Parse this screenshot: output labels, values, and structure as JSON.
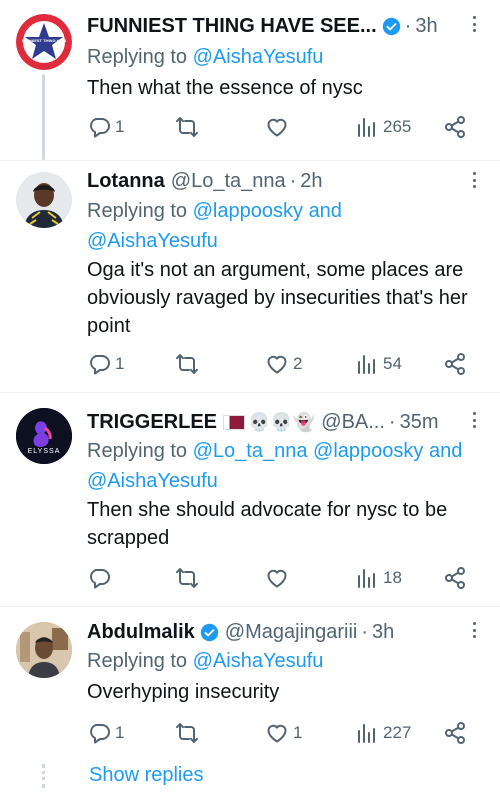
{
  "tweets": [
    {
      "name": "FUNNIEST THING HAVE SEE...",
      "verified": true,
      "handle": "",
      "time": "3h",
      "replying_label": "Replying to",
      "mentions": [
        "@AishaYesufu"
      ],
      "text": "Then what the essence of nysc",
      "replies": "1",
      "retweets": "",
      "likes": "",
      "views": "265",
      "avatar_logo_text": "FUNNIEST THING HAVE SEEN"
    },
    {
      "name": "Lotanna",
      "verified": false,
      "handle": "@Lo_ta_nna",
      "time": "2h",
      "replying_label": "Replying to",
      "mentions": [
        "@lappoosky",
        "@AishaYesufu"
      ],
      "joiner": "and",
      "text": "Oga  it's not an argument, some places are obviously ravaged by insecurities that's her point",
      "replies": "1",
      "retweets": "",
      "likes": "2",
      "views": "54"
    },
    {
      "name": "TRIGGERLEE",
      "verified": false,
      "name_emojis": "💀💀👻",
      "handle": "@BA...",
      "time": "35m",
      "replying_label": "Replying to",
      "mentions": [
        "@Lo_ta_nna",
        "@lappoosky",
        "@AishaYesufu"
      ],
      "joiner": "and",
      "text": "Then she should advocate for nysc to be scrapped",
      "replies": "",
      "retweets": "",
      "likes": "",
      "views": "18",
      "avatar_logo_text": "ELYSSA"
    },
    {
      "name": "Abdulmalik",
      "verified": true,
      "handle": "@Magajingariii",
      "time": "3h",
      "replying_label": "Replying to",
      "mentions": [
        "@AishaYesufu"
      ],
      "text": "Overhyping insecurity",
      "replies": "1",
      "retweets": "",
      "likes": "1",
      "views": "227"
    }
  ],
  "show_replies": "Show replies",
  "separator": "·",
  "colors": {
    "link": "#1d9bf0",
    "secondary": "#536471",
    "verified": "#1d9bf0",
    "thread_line": "#cfd9de"
  },
  "icons": {
    "reply": "reply-icon",
    "retweet": "retweet-icon",
    "like": "heart-icon",
    "views": "views-icon",
    "share": "share-icon",
    "more": "more-icon",
    "verified": "verified-badge-icon"
  }
}
